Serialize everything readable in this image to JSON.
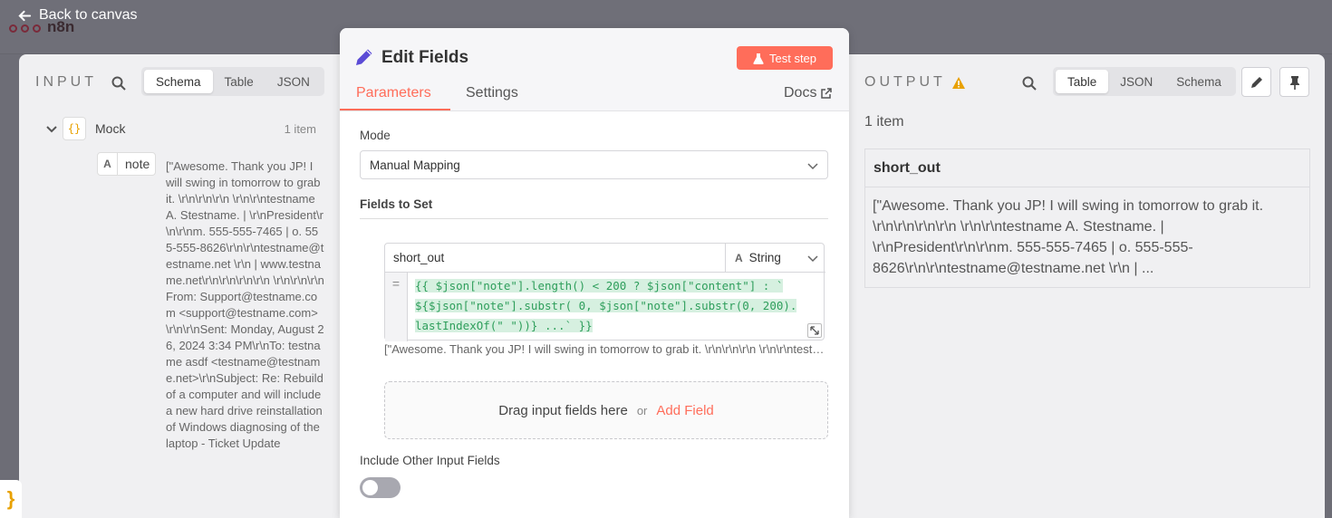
{
  "back": {
    "label": "Back to canvas"
  },
  "logo": {
    "text": "n8n"
  },
  "input": {
    "title": "INPUT",
    "tabs": [
      "Schema",
      "Table",
      "JSON"
    ],
    "active_tab": "Schema",
    "root": {
      "name": "Mock",
      "count": "1 item",
      "badge": "{}"
    },
    "field": {
      "type_badge": "A",
      "name": "note",
      "value": "[\"Awesome. Thank you JP! I will swing in tomorrow to grab it. \\r\\n\\r\\n\\r\\n \\r\\n\\r\\ntestname A. Stestname. | \\r\\nPresident\\r\\n\\r\\nm. 555-555-7465 | o. 555-555-8626\\r\\n\\r\\ntestname@testname.net \\r\\n | www.testname.net\\r\\n\\r\\n\\r\\n\\r\\n \\r\\n\\r\\n\\r\\nFrom: Support@testname.com <support@testname.com>\\r\\n\\r\\nSent: Monday, August 26, 2024 3:34 PM\\r\\nTo: testname asdf <testname@testname.net>\\r\\nSubject: Re: Rebuild of a computer and will include a new hard drive reinstallation of Windows diagnosing of the laptop - Ticket Update"
    }
  },
  "node": {
    "title": "Edit Fields",
    "test_button": "Test step",
    "tabs": [
      "Parameters",
      "Settings"
    ],
    "docs": "Docs",
    "mode_label": "Mode",
    "mode_value": "Manual Mapping",
    "fields_label": "Fields to Set",
    "assignment": {
      "name": "short_out",
      "type": "String",
      "type_icon": "A",
      "eq": "=",
      "expr_line1": "{{ $json[\"note\"].length() < 200 ? $json[\"content\"] : `",
      "expr_line2": "${$json[\"note\"].substr( 0, $json[\"note\"].substr(0, 200).",
      "expr_line3": "lastIndexOf(\" \"))} ...` }}",
      "preview": "[\"Awesome. Thank you JP! I will swing in tomorrow to grab it. \\r\\n\\r\\n\\r\\n \\r\\n\\r\\ntestname A. Stestname."
    },
    "drop_text": "Drag input fields here",
    "drop_or": "or",
    "add_field": "Add Field",
    "include_label": "Include Other Input Fields",
    "include_on": false
  },
  "output": {
    "title": "OUTPUT",
    "tabs": [
      "Table",
      "JSON",
      "Schema"
    ],
    "active_tab": "Table",
    "count": "1 item",
    "column": "short_out",
    "value": "[\"Awesome. Thank you JP! I will swing in tomorrow to grab it. \\r\\n\\r\\n\\r\\n\\r\\n \\r\\n\\r\\ntestname A. Stestname. | \\r\\nPresident\\r\\n\\r\\nm. 555-555-7465   |   o. 555-555-8626\\r\\n\\r\\ntestname@testname.net  \\r\\n |  ...",
    "warning_color": "#e8a100"
  },
  "colors": {
    "accent": "#ff6d5a",
    "expression": "#2e9e5b",
    "pencil": "#5b4bd6"
  }
}
